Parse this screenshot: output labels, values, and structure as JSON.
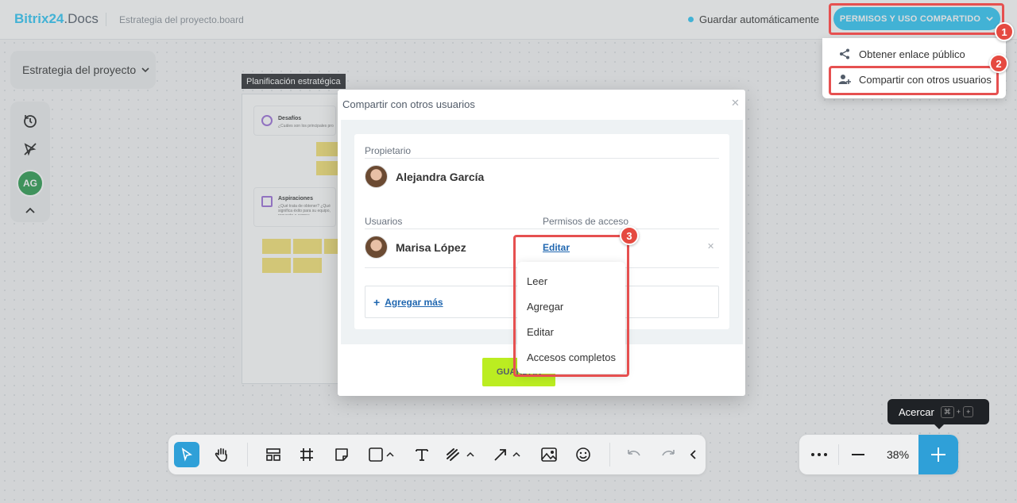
{
  "header": {
    "logo_brand": "Bitrix24",
    "logo_suffix": ".Docs",
    "document_name": "Estrategia del proyecto.board",
    "autosave_label": "Guardar automáticamente",
    "share_button_label": "PERMISOS Y USO COMPARTIDO"
  },
  "share_menu": {
    "items": [
      {
        "label": "Obtener enlace público",
        "icon": "share-icon"
      },
      {
        "label": "Compartir con otros usuarios",
        "icon": "add-user-icon"
      }
    ]
  },
  "left_panel": {
    "board_select_label": "Estrategia del proyecto",
    "avatar_initials": "AG"
  },
  "board": {
    "frame_label": "Planificación estratégica",
    "cards": [
      {
        "title": "Desafíos",
        "subtitle": "¿Cuáles son los principales problemas..."
      },
      {
        "title": "Aspiraciones",
        "subtitle": "¿Qué trata de obtener? ¿Qué significa éxito para su equipo, proyecto o compa..."
      }
    ]
  },
  "modal": {
    "title": "Compartir con otros usuarios",
    "owner_label": "Propietario",
    "owner_name": "Alejandra García",
    "users_label": "Usuarios",
    "access_label": "Permisos de acceso",
    "users": [
      {
        "name": "Marisa López",
        "permission": "Editar"
      }
    ],
    "add_more_label": "Agregar más",
    "save_label": "GUARDAR"
  },
  "permission_menu": {
    "options": [
      "Leer",
      "Agregar",
      "Editar",
      "Accesos completos"
    ]
  },
  "annotations": [
    "1",
    "2",
    "3"
  ],
  "zoom": {
    "level": "38%",
    "tooltip_label": "Acercar",
    "shortcut_keys": [
      "⌘",
      "+",
      "+"
    ]
  },
  "colors": {
    "accent": "#2fc6f6",
    "highlight": "#e65050",
    "save_button": "#bbed21",
    "zoom_plus": "#2fa0d8",
    "avatar_bg": "#2a9a4e"
  }
}
